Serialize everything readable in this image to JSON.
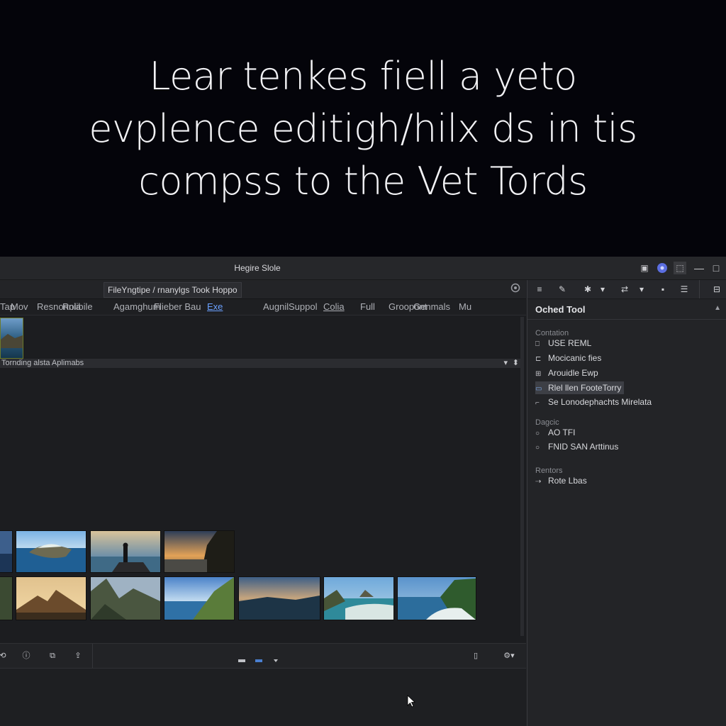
{
  "hero": {
    "lines": [
      "Lear tenkes fiell a yeto",
      "evplence editigh/hilx ds in tis",
      "compss to the Vet Tords"
    ]
  },
  "window": {
    "title": "Hegire Slole"
  },
  "path": {
    "text": "FileYngtipe / rnanylgs Took Hoppo"
  },
  "tabs": [
    "Tap",
    "Mov",
    "Resnonnia",
    "Rolibile",
    "Agamghum",
    "Flieber Bau",
    "Exe",
    "Augnil",
    "Suppol",
    "Colia",
    "Full",
    "Groopont",
    "Genmals",
    "Mu"
  ],
  "active_tab": "Exe",
  "info_bar": {
    "label": "Tornding alsta Aplimabs"
  },
  "side_panel": {
    "title": "Oched Tool",
    "sections": [
      {
        "label": "Contation",
        "items": [
          {
            "label": "USE REML",
            "icon": "doc-icon",
            "selected": false
          },
          {
            "label": "Mocicanic fies",
            "icon": "folder-icon",
            "selected": false
          },
          {
            "label": "Arouidle Ewp",
            "icon": "grid-icon",
            "selected": false
          },
          {
            "label": "Rlel llen FooteTorry",
            "icon": "image-icon",
            "selected": true
          },
          {
            "label": "Se Lonodephachts Mirelata",
            "icon": "bracket-icon",
            "selected": false
          }
        ]
      },
      {
        "label": "Dagcic",
        "items": [
          {
            "label": "AO TFI",
            "icon": "radio-icon",
            "selected": false
          },
          {
            "label": "FNID SAN Arttinus",
            "icon": "radio-icon",
            "selected": false
          }
        ]
      },
      {
        "label": "Rentors",
        "items": [
          {
            "label": "Rote Lbas",
            "icon": "arrow-icon",
            "selected": false
          }
        ]
      }
    ]
  },
  "colors": {
    "accent": "#6aa0ff",
    "panel_bg": "#232427",
    "main_bg": "#1c1d20",
    "hero_bg": "#04040a"
  }
}
